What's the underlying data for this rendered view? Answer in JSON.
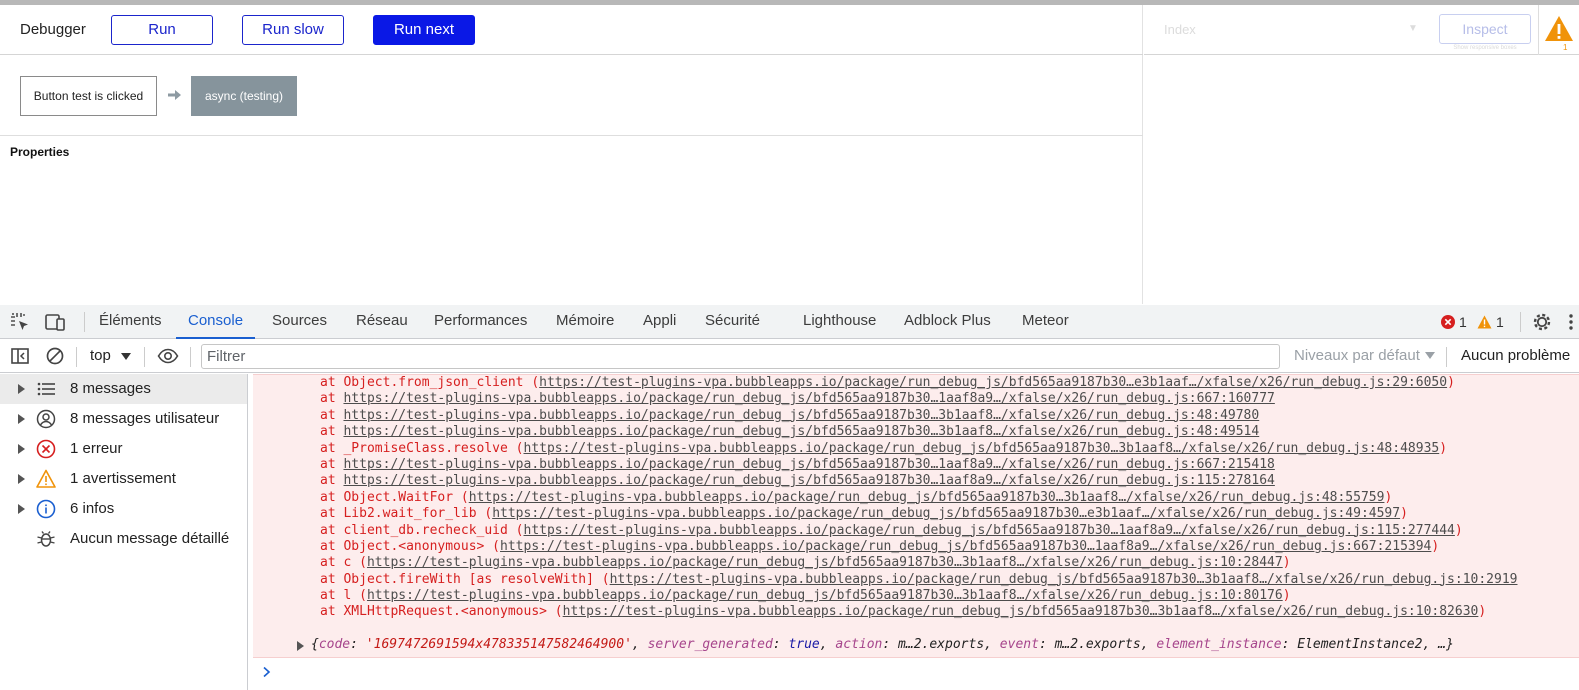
{
  "debugger": {
    "title": "Debugger",
    "buttons": {
      "run": "Run",
      "run_slow": "Run slow",
      "run_next": "Run next"
    },
    "steps": {
      "trigger": "Button test is clicked",
      "action": "async (testing)"
    },
    "properties_label": "Properties"
  },
  "inspector": {
    "index_placeholder": "Index",
    "inspect_label": "Inspect",
    "inspect_sub": "Show responsive boxes",
    "warning_count": "1"
  },
  "devtools": {
    "tabs": [
      "Éléments",
      "Console",
      "Sources",
      "Réseau",
      "Performances",
      "Mémoire",
      "Appli",
      "Sécurité",
      "Lighthouse",
      "Adblock Plus",
      "Meteor"
    ],
    "active_tab": "Console",
    "error_count": "1",
    "warning_count": "1",
    "context": "top",
    "filter_placeholder": "Filtrer",
    "levels": "Niveaux par défaut",
    "issues": "Aucun problème",
    "sidebar": [
      {
        "label": "8 messages",
        "icon": "list-icon"
      },
      {
        "label": "8 messages utilisateur",
        "icon": "user-icon"
      },
      {
        "label": "1 erreur",
        "icon": "error-icon"
      },
      {
        "label": "1 avertissement",
        "icon": "warning-icon"
      },
      {
        "label": "6 infos",
        "icon": "info-icon"
      },
      {
        "label": "Aucun message détaillé",
        "icon": "bug-icon"
      }
    ],
    "trace": [
      {
        "prefix": "at Object.from_json_client (",
        "url": "https://test-plugins-vpa.bubbleapps.io/package/run_debug_js/bfd565aa9187b30…e3b1aaf…/xfalse/x26/run_debug.js:29:6050",
        "suffix": ")"
      },
      {
        "prefix": "at ",
        "url": "https://test-plugins-vpa.bubbleapps.io/package/run_debug_js/bfd565aa9187b30…1aaf8a9…/xfalse/x26/run_debug.js:667:160777",
        "suffix": ""
      },
      {
        "prefix": "at ",
        "url": "https://test-plugins-vpa.bubbleapps.io/package/run_debug_js/bfd565aa9187b30…3b1aaf8…/xfalse/x26/run_debug.js:48:49780",
        "suffix": ""
      },
      {
        "prefix": "at ",
        "url": "https://test-plugins-vpa.bubbleapps.io/package/run_debug_js/bfd565aa9187b30…3b1aaf8…/xfalse/x26/run_debug.js:48:49514",
        "suffix": ""
      },
      {
        "prefix": "at _PromiseClass.resolve (",
        "url": "https://test-plugins-vpa.bubbleapps.io/package/run_debug_js/bfd565aa9187b30…3b1aaf8…/xfalse/x26/run_debug.js:48:48935",
        "suffix": ")"
      },
      {
        "prefix": "at ",
        "url": "https://test-plugins-vpa.bubbleapps.io/package/run_debug_js/bfd565aa9187b30…1aaf8a9…/xfalse/x26/run_debug.js:667:215418",
        "suffix": ""
      },
      {
        "prefix": "at ",
        "url": "https://test-plugins-vpa.bubbleapps.io/package/run_debug_js/bfd565aa9187b30…1aaf8a9…/xfalse/x26/run_debug.js:115:278164",
        "suffix": ""
      },
      {
        "prefix": "at Object.WaitFor (",
        "url": "https://test-plugins-vpa.bubbleapps.io/package/run_debug_js/bfd565aa9187b30…3b1aaf8…/xfalse/x26/run_debug.js:48:55759",
        "suffix": ")"
      },
      {
        "prefix": "at Lib2.wait_for_lib (",
        "url": "https://test-plugins-vpa.bubbleapps.io/package/run_debug_js/bfd565aa9187b30…e3b1aaf…/xfalse/x26/run_debug.js:49:4597",
        "suffix": ")"
      },
      {
        "prefix": "at client_db.recheck_uid (",
        "url": "https://test-plugins-vpa.bubbleapps.io/package/run_debug_js/bfd565aa9187b30…1aaf8a9…/xfalse/x26/run_debug.js:115:277444",
        "suffix": ")"
      },
      {
        "prefix": "at Object.<anonymous> (",
        "url": "https://test-plugins-vpa.bubbleapps.io/package/run_debug_js/bfd565aa9187b30…1aaf8a9…/xfalse/x26/run_debug.js:667:215394",
        "suffix": ")"
      },
      {
        "prefix": "at c (",
        "url": "https://test-plugins-vpa.bubbleapps.io/package/run_debug_js/bfd565aa9187b30…3b1aaf8…/xfalse/x26/run_debug.js:10:28447",
        "suffix": ")"
      },
      {
        "prefix": "at Object.fireWith [as resolveWith] (",
        "url": "https://test-plugins-vpa.bubbleapps.io/package/run_debug_js/bfd565aa9187b30…3b1aaf8…/xfalse/x26/run_debug.js:10:2919",
        "suffix": ""
      },
      {
        "prefix": "at l (",
        "url": "https://test-plugins-vpa.bubbleapps.io/package/run_debug_js/bfd565aa9187b30…3b1aaf8…/xfalse/x26/run_debug.js:10:80176",
        "suffix": ")"
      },
      {
        "prefix": "at XMLHttpRequest.<anonymous> (",
        "url": "https://test-plugins-vpa.bubbleapps.io/package/run_debug_js/bfd565aa9187b30…3b1aaf8…/xfalse/x26/run_debug.js:10:82630",
        "suffix": ")"
      }
    ],
    "object_summary": {
      "code_key": "code",
      "code_val": "'1697472691594x478335147582464900'",
      "sg_key": "server_generated",
      "sg_val": "true",
      "action_key": "action",
      "action_val": "m…2.exports",
      "event_key": "event",
      "event_val": "m…2.exports",
      "ei_key": "element_instance",
      "ei_val": "ElementInstance2, …}"
    }
  },
  "colors": {
    "run_next_bg": "#0a18e6",
    "error_red": "#d61f1f",
    "active_tab": "#1a5fd0",
    "warning": "#f0930a"
  }
}
